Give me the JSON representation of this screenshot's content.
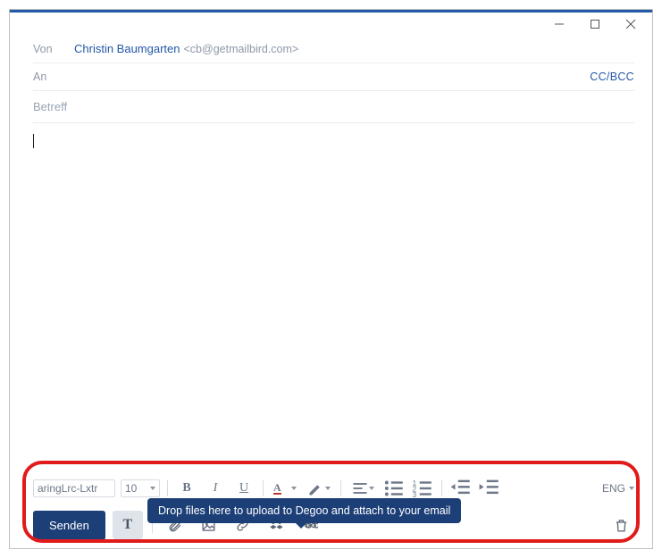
{
  "window": {
    "minimize": "Minimize",
    "maximize": "Maximize",
    "close": "Close"
  },
  "from": {
    "label": "Von",
    "name": "Christin Baumgarten",
    "address": "<cb@getmailbird.com>"
  },
  "to": {
    "label": "An",
    "ccbcc": "CC/BCC"
  },
  "subject": {
    "placeholder": "Betreff"
  },
  "body": {
    "content": ""
  },
  "format": {
    "font_name": "aringLrc-Lxtr",
    "font_size": "10",
    "buttons": {
      "bold": "B",
      "italic": "I",
      "underline": "U",
      "font_color": "A",
      "highlight": "Highlight",
      "align": "Align",
      "list_ul": "Bulleted list",
      "list_ol": "Numbered list",
      "outdent": "Outdent",
      "indent": "Indent"
    },
    "language": "ENG"
  },
  "tooltip": "Drop files here to upload to Degoo and attach to your email",
  "actions": {
    "send": "Senden",
    "format_toggle": "T",
    "attach": "Attach",
    "image": "Insert image",
    "link": "Insert link",
    "dropbox": "Dropbox",
    "degoo": "Degoo",
    "delete": "Delete"
  }
}
